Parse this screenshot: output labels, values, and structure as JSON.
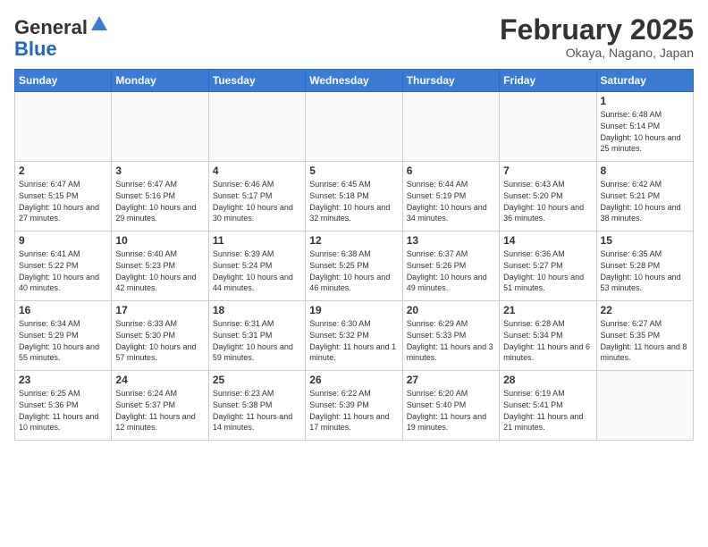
{
  "header": {
    "logo_general": "General",
    "logo_blue": "Blue",
    "month_title": "February 2025",
    "location": "Okaya, Nagano, Japan"
  },
  "weekdays": [
    "Sunday",
    "Monday",
    "Tuesday",
    "Wednesday",
    "Thursday",
    "Friday",
    "Saturday"
  ],
  "weeks": [
    [
      {
        "day": "",
        "info": ""
      },
      {
        "day": "",
        "info": ""
      },
      {
        "day": "",
        "info": ""
      },
      {
        "day": "",
        "info": ""
      },
      {
        "day": "",
        "info": ""
      },
      {
        "day": "",
        "info": ""
      },
      {
        "day": "1",
        "info": "Sunrise: 6:48 AM\nSunset: 5:14 PM\nDaylight: 10 hours and 25 minutes."
      }
    ],
    [
      {
        "day": "2",
        "info": "Sunrise: 6:47 AM\nSunset: 5:15 PM\nDaylight: 10 hours and 27 minutes."
      },
      {
        "day": "3",
        "info": "Sunrise: 6:47 AM\nSunset: 5:16 PM\nDaylight: 10 hours and 29 minutes."
      },
      {
        "day": "4",
        "info": "Sunrise: 6:46 AM\nSunset: 5:17 PM\nDaylight: 10 hours and 30 minutes."
      },
      {
        "day": "5",
        "info": "Sunrise: 6:45 AM\nSunset: 5:18 PM\nDaylight: 10 hours and 32 minutes."
      },
      {
        "day": "6",
        "info": "Sunrise: 6:44 AM\nSunset: 5:19 PM\nDaylight: 10 hours and 34 minutes."
      },
      {
        "day": "7",
        "info": "Sunrise: 6:43 AM\nSunset: 5:20 PM\nDaylight: 10 hours and 36 minutes."
      },
      {
        "day": "8",
        "info": "Sunrise: 6:42 AM\nSunset: 5:21 PM\nDaylight: 10 hours and 38 minutes."
      }
    ],
    [
      {
        "day": "9",
        "info": "Sunrise: 6:41 AM\nSunset: 5:22 PM\nDaylight: 10 hours and 40 minutes."
      },
      {
        "day": "10",
        "info": "Sunrise: 6:40 AM\nSunset: 5:23 PM\nDaylight: 10 hours and 42 minutes."
      },
      {
        "day": "11",
        "info": "Sunrise: 6:39 AM\nSunset: 5:24 PM\nDaylight: 10 hours and 44 minutes."
      },
      {
        "day": "12",
        "info": "Sunrise: 6:38 AM\nSunset: 5:25 PM\nDaylight: 10 hours and 46 minutes."
      },
      {
        "day": "13",
        "info": "Sunrise: 6:37 AM\nSunset: 5:26 PM\nDaylight: 10 hours and 49 minutes."
      },
      {
        "day": "14",
        "info": "Sunrise: 6:36 AM\nSunset: 5:27 PM\nDaylight: 10 hours and 51 minutes."
      },
      {
        "day": "15",
        "info": "Sunrise: 6:35 AM\nSunset: 5:28 PM\nDaylight: 10 hours and 53 minutes."
      }
    ],
    [
      {
        "day": "16",
        "info": "Sunrise: 6:34 AM\nSunset: 5:29 PM\nDaylight: 10 hours and 55 minutes."
      },
      {
        "day": "17",
        "info": "Sunrise: 6:33 AM\nSunset: 5:30 PM\nDaylight: 10 hours and 57 minutes."
      },
      {
        "day": "18",
        "info": "Sunrise: 6:31 AM\nSunset: 5:31 PM\nDaylight: 10 hours and 59 minutes."
      },
      {
        "day": "19",
        "info": "Sunrise: 6:30 AM\nSunset: 5:32 PM\nDaylight: 11 hours and 1 minute."
      },
      {
        "day": "20",
        "info": "Sunrise: 6:29 AM\nSunset: 5:33 PM\nDaylight: 11 hours and 3 minutes."
      },
      {
        "day": "21",
        "info": "Sunrise: 6:28 AM\nSunset: 5:34 PM\nDaylight: 11 hours and 6 minutes."
      },
      {
        "day": "22",
        "info": "Sunrise: 6:27 AM\nSunset: 5:35 PM\nDaylight: 11 hours and 8 minutes."
      }
    ],
    [
      {
        "day": "23",
        "info": "Sunrise: 6:25 AM\nSunset: 5:36 PM\nDaylight: 11 hours and 10 minutes."
      },
      {
        "day": "24",
        "info": "Sunrise: 6:24 AM\nSunset: 5:37 PM\nDaylight: 11 hours and 12 minutes."
      },
      {
        "day": "25",
        "info": "Sunrise: 6:23 AM\nSunset: 5:38 PM\nDaylight: 11 hours and 14 minutes."
      },
      {
        "day": "26",
        "info": "Sunrise: 6:22 AM\nSunset: 5:39 PM\nDaylight: 11 hours and 17 minutes."
      },
      {
        "day": "27",
        "info": "Sunrise: 6:20 AM\nSunset: 5:40 PM\nDaylight: 11 hours and 19 minutes."
      },
      {
        "day": "28",
        "info": "Sunrise: 6:19 AM\nSunset: 5:41 PM\nDaylight: 11 hours and 21 minutes."
      },
      {
        "day": "",
        "info": ""
      }
    ]
  ]
}
